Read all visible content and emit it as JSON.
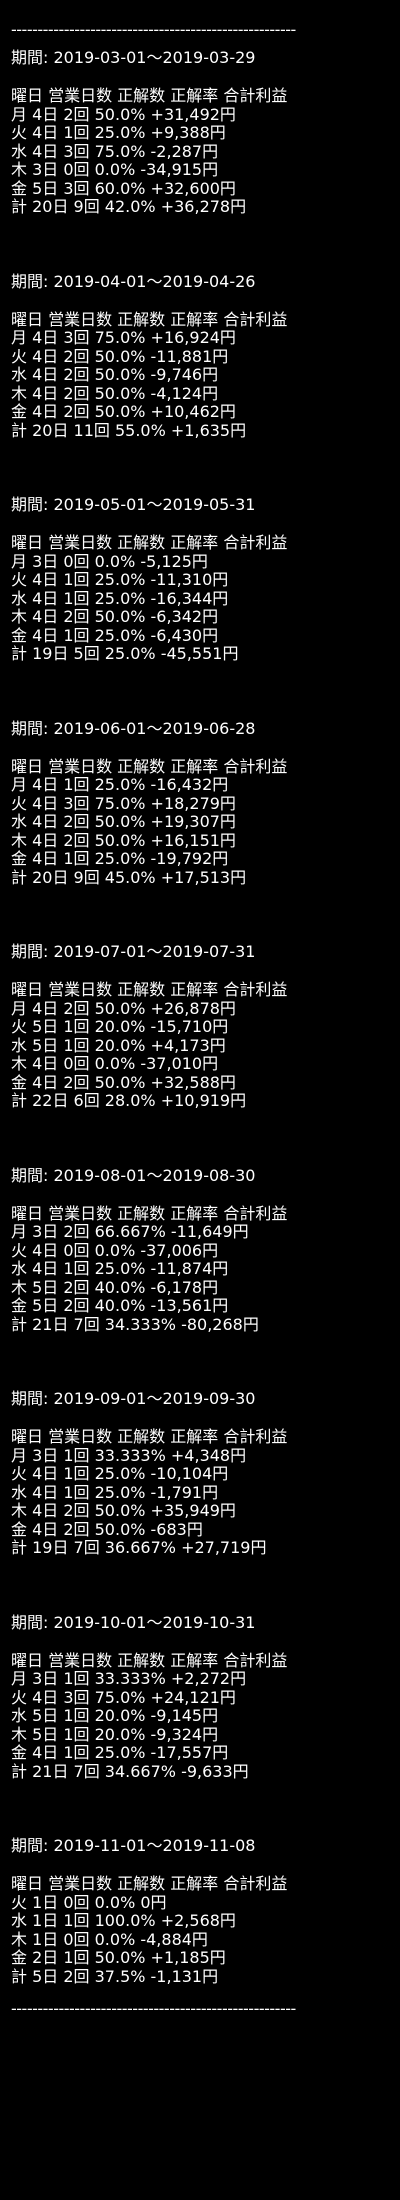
{
  "divider": "------------------------------------------------------",
  "period_label": "期間: ",
  "header": "曜日 営業日数 正解数 正解率 合計利益",
  "periods": [
    {
      "range": "2019-03-01～2019-03-29",
      "rows": [
        "月 4日 2回 50.0% +31,492円",
        "火 4日 1回 25.0% +9,388円",
        "水 4日 3回 75.0% -2,287円",
        "木 3日 0回 0.0% -34,915円",
        "金 5日 3回 60.0% +32,600円",
        "計 20日 9回 42.0% +36,278円"
      ]
    },
    {
      "range": "2019-04-01～2019-04-26",
      "rows": [
        "月 4日 3回 75.0% +16,924円",
        "火 4日 2回 50.0% -11,881円",
        "水 4日 2回 50.0% -9,746円",
        "木 4日 2回 50.0% -4,124円",
        "金 4日 2回 50.0% +10,462円",
        "計 20日 11回 55.0% +1,635円"
      ]
    },
    {
      "range": "2019-05-01～2019-05-31",
      "rows": [
        "月 3日 0回 0.0% -5,125円",
        "火 4日 1回 25.0% -11,310円",
        "水 4日 1回 25.0% -16,344円",
        "木 4日 2回 50.0% -6,342円",
        "金 4日 1回 25.0% -6,430円",
        "計 19日 5回 25.0% -45,551円"
      ]
    },
    {
      "range": "2019-06-01～2019-06-28",
      "rows": [
        "月 4日 1回 25.0% -16,432円",
        "火 4日 3回 75.0% +18,279円",
        "水 4日 2回 50.0% +19,307円",
        "木 4日 2回 50.0% +16,151円",
        "金 4日 1回 25.0% -19,792円",
        "計 20日 9回 45.0% +17,513円"
      ]
    },
    {
      "range": "2019-07-01～2019-07-31",
      "rows": [
        "月 4日 2回 50.0% +26,878円",
        "火 5日 1回 20.0% -15,710円",
        "水 5日 1回 20.0% +4,173円",
        "木 4日 0回 0.0% -37,010円",
        "金 4日 2回 50.0% +32,588円",
        "計 22日 6回 28.0% +10,919円"
      ]
    },
    {
      "range": "2019-08-01～2019-08-30",
      "rows": [
        "月 3日 2回 66.667% -11,649円",
        "火 4日 0回 0.0% -37,006円",
        "水 4日 1回 25.0% -11,874円",
        "木 5日 2回 40.0% -6,178円",
        "金 5日 2回 40.0% -13,561円",
        "計 21日 7回 34.333% -80,268円"
      ]
    },
    {
      "range": "2019-09-01～2019-09-30",
      "rows": [
        "月 3日 1回 33.333% +4,348円",
        "火 4日 1回 25.0% -10,104円",
        "水 4日 1回 25.0% -1,791円",
        "木 4日 2回 50.0% +35,949円",
        "金 4日 2回 50.0% -683円",
        "計 19日 7回 36.667% +27,719円"
      ]
    },
    {
      "range": "2019-10-01～2019-10-31",
      "rows": [
        "月 3日 1回 33.333% +2,272円",
        "火 4日 3回 75.0% +24,121円",
        "水 5日 1回 20.0% -9,145円",
        "木 5日 1回 20.0% -9,324円",
        "金 4日 1回 25.0% -17,557円",
        "計 21日 7回 34.667% -9,633円"
      ]
    },
    {
      "range": "2019-11-01～2019-11-08",
      "rows": [
        "火 1日 0回 0.0% 0円",
        "水 1日 1回 100.0% +2,568円",
        "木 1日 0回 0.0% -4,884円",
        "金 2日 1回 50.0% +1,185円",
        "計 5日 2回 37.5% -1,131円"
      ]
    }
  ],
  "colors": {
    "background": "#000000",
    "text": "#ffffff"
  }
}
